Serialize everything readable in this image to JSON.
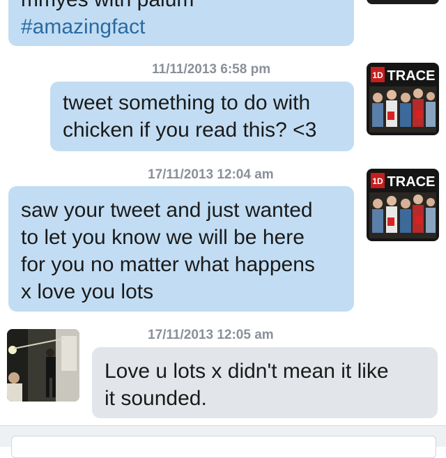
{
  "conversation": {
    "messages": [
      {
        "direction": "sent",
        "lines": [
          "mmyes with palum",
          "#amazingfact"
        ]
      },
      {
        "direction": "sent",
        "timestamp": "11/11/2013 6:58 pm",
        "lines": [
          "tweet something to do with",
          "chicken if you read this? <3"
        ],
        "avatar": "1D TRACE"
      },
      {
        "direction": "sent",
        "timestamp": "17/11/2013 12:04 am",
        "lines": [
          "saw your tweet and just wanted",
          "to let you know we will be here",
          "for you no matter what happens",
          "x love you lots"
        ],
        "avatar": "1D TRACE"
      },
      {
        "direction": "received",
        "timestamp": "17/11/2013 12:05 am",
        "lines": [
          "Love u lots x didn't mean it like",
          "it sounded."
        ],
        "avatar": "photo"
      }
    ]
  },
  "colors": {
    "sent_bubble": "#c2ddf3",
    "received_bubble": "#e2e6ea",
    "hashtag": "#2a6aa2",
    "timestamp": "#8a9099"
  },
  "icons": {
    "sender_avatar": "1d-trace-avatar-icon",
    "receiver_avatar": "photo-avatar-icon"
  }
}
